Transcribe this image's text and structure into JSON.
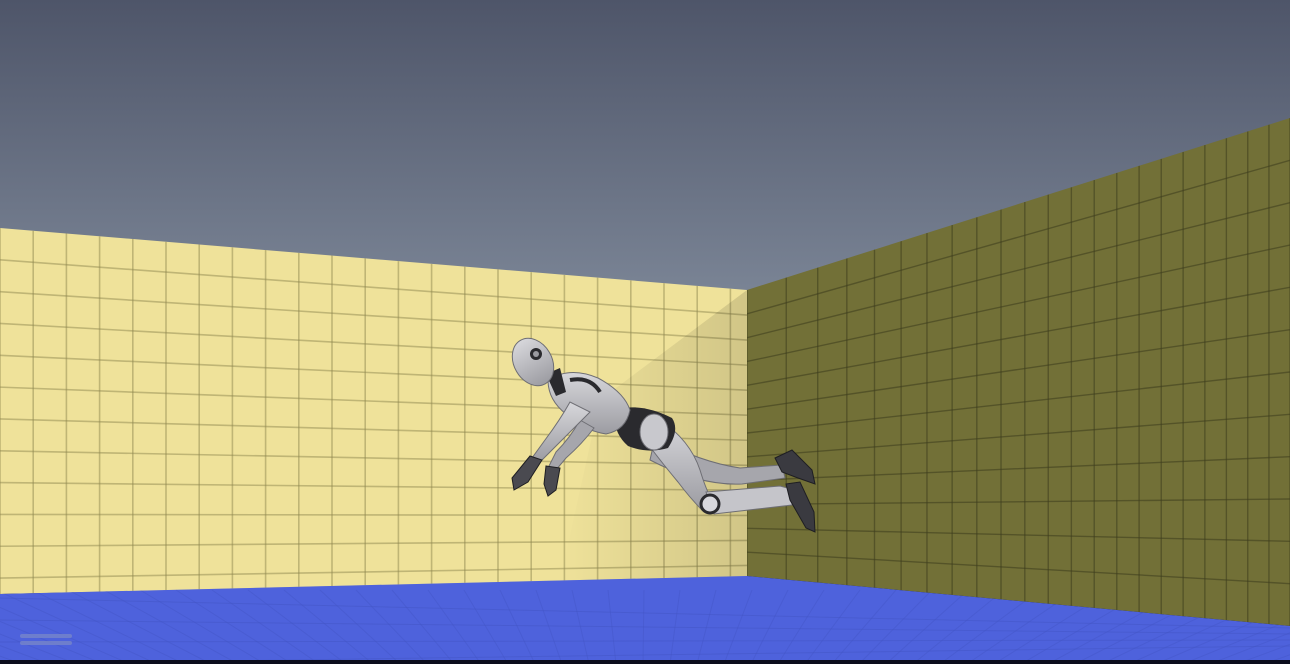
{
  "scene": {
    "view": "3d-game-viewport",
    "character": "grey-mannequin-robot",
    "pose": "diving-midair",
    "colors": {
      "sky_top": "#4e5569",
      "sky_bottom": "#7b8596",
      "back_wall": "#efe29a",
      "back_wall_grid": "#8f884f",
      "right_wall": "#727037",
      "right_wall_grid": "#3d3c1d",
      "floor": "#4a5ed8",
      "floor_grid": "#3a4cb8",
      "robot_body": "#c2c2c6",
      "robot_joint": "#2a2a2e"
    }
  },
  "hud": {
    "indicator_icon": "menu-bars-icon",
    "indicator_color": "#7a88c8"
  }
}
